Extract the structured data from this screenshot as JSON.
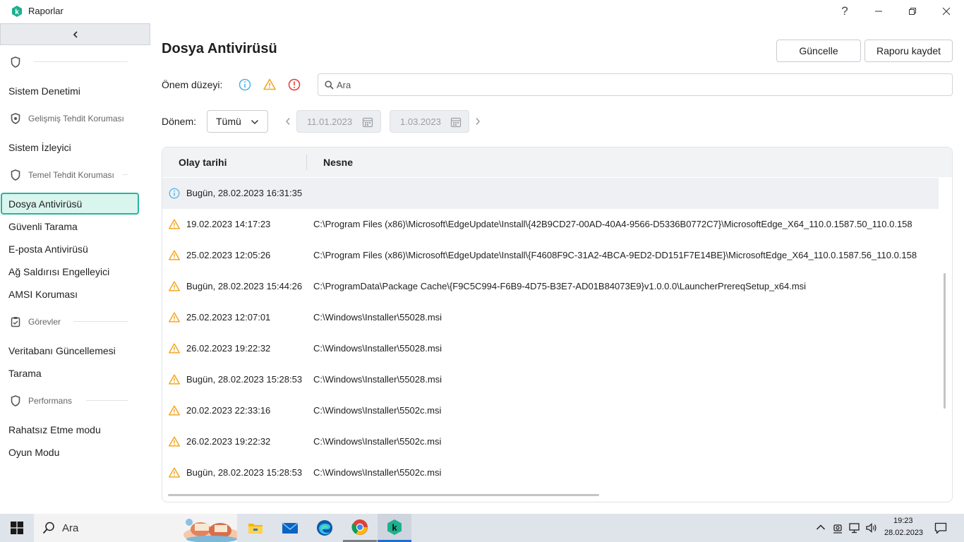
{
  "window": {
    "title": "Raporlar",
    "help_glyph": "?",
    "icons": [
      "kaspersky-logo-icon",
      "help-icon",
      "minimize-icon",
      "restore-icon",
      "close-icon"
    ]
  },
  "sidebar": {
    "collapse_icon": "chevron-left-icon",
    "sections": [
      {
        "label": "",
        "icon": "shield-icon",
        "items": [
          "Sistem Denetimi"
        ]
      },
      {
        "label": "Gelişmiş Tehdit Koruması",
        "icon": "shield-icon",
        "items": [
          "Sistem İzleyici"
        ]
      },
      {
        "label": "Temel Tehdit Koruması",
        "icon": "shield-icon",
        "items": [
          "Dosya Antivirüsü",
          "Güvenli Tarama",
          "E-posta Antivirüsü",
          "Ağ Saldırısı Engelleyici",
          "AMSI Koruması"
        ]
      },
      {
        "label": "Görevler",
        "icon": "clipboard-icon",
        "items": [
          "Veritabanı Güncellemesi",
          "Tarama"
        ]
      },
      {
        "label": "Performans",
        "icon": "shield-icon",
        "items": [
          "Rahatsız Etme modu",
          "Oyun Modu"
        ]
      }
    ],
    "active_item": "Dosya Antivirüsü"
  },
  "main": {
    "title": "Dosya Antivirüsü",
    "update_button": "Güncelle",
    "save_report_button": "Raporu kaydet",
    "severity_label": "Önem düzeyi:",
    "severity_icons": [
      "info-icon",
      "warning-icon",
      "error-icon"
    ],
    "search_placeholder": "Ara",
    "period_label": "Dönem:",
    "period_value": "Tümü",
    "date_from": "11.01.2023",
    "date_to": "1.03.2023",
    "colors": {
      "accent": "#2ab3a0",
      "warning": "#f5a623",
      "info": "#4fb3e8",
      "error": "#e53935"
    }
  },
  "table": {
    "columns": [
      "Olay tarihi",
      "Nesne"
    ],
    "rows": [
      {
        "type": "info",
        "date": "Bugün, 28.02.2023 16:31:35",
        "object": ""
      },
      {
        "type": "warning",
        "date": "19.02.2023 14:17:23",
        "object": "C:\\Program Files (x86)\\Microsoft\\EdgeUpdate\\Install\\{42B9CD27-00AD-40A4-9566-D5336B0772C7}\\MicrosoftEdge_X64_110.0.1587.50_110.0.158"
      },
      {
        "type": "warning",
        "date": "25.02.2023 12:05:26",
        "object": "C:\\Program Files (x86)\\Microsoft\\EdgeUpdate\\Install\\{F4608F9C-31A2-4BCA-9ED2-DD151F7E14BE}\\MicrosoftEdge_X64_110.0.1587.56_110.0.158"
      },
      {
        "type": "warning",
        "date": "Bugün, 28.02.2023 15:44:26",
        "object": "C:\\ProgramData\\Package Cache\\{F9C5C994-F6B9-4D75-B3E7-AD01B84073E9}v1.0.0.0\\LauncherPrereqSetup_x64.msi"
      },
      {
        "type": "warning",
        "date": "25.02.2023 12:07:01",
        "object": "C:\\Windows\\Installer\\55028.msi"
      },
      {
        "type": "warning",
        "date": "26.02.2023 19:22:32",
        "object": "C:\\Windows\\Installer\\55028.msi"
      },
      {
        "type": "warning",
        "date": "Bugün, 28.02.2023 15:28:53",
        "object": "C:\\Windows\\Installer\\55028.msi"
      },
      {
        "type": "warning",
        "date": "20.02.2023 22:33:16",
        "object": "C:\\Windows\\Installer\\5502c.msi"
      },
      {
        "type": "warning",
        "date": "26.02.2023 19:22:32",
        "object": "C:\\Windows\\Installer\\5502c.msi"
      },
      {
        "type": "warning",
        "date": "Bugün, 28.02.2023 15:28:53",
        "object": "C:\\Windows\\Installer\\5502c.msi"
      }
    ]
  },
  "taskbar": {
    "search_text": "Ara",
    "apps": [
      "windows-start-icon",
      "file-explorer-icon",
      "mail-icon",
      "edge-icon",
      "chrome-icon",
      "kaspersky-icon"
    ],
    "tray_icons": [
      "chevron-up-icon",
      "meet-icon",
      "network-icon",
      "volume-icon",
      "notification-icon"
    ],
    "time": "19:23",
    "date": "28.02.2023"
  }
}
